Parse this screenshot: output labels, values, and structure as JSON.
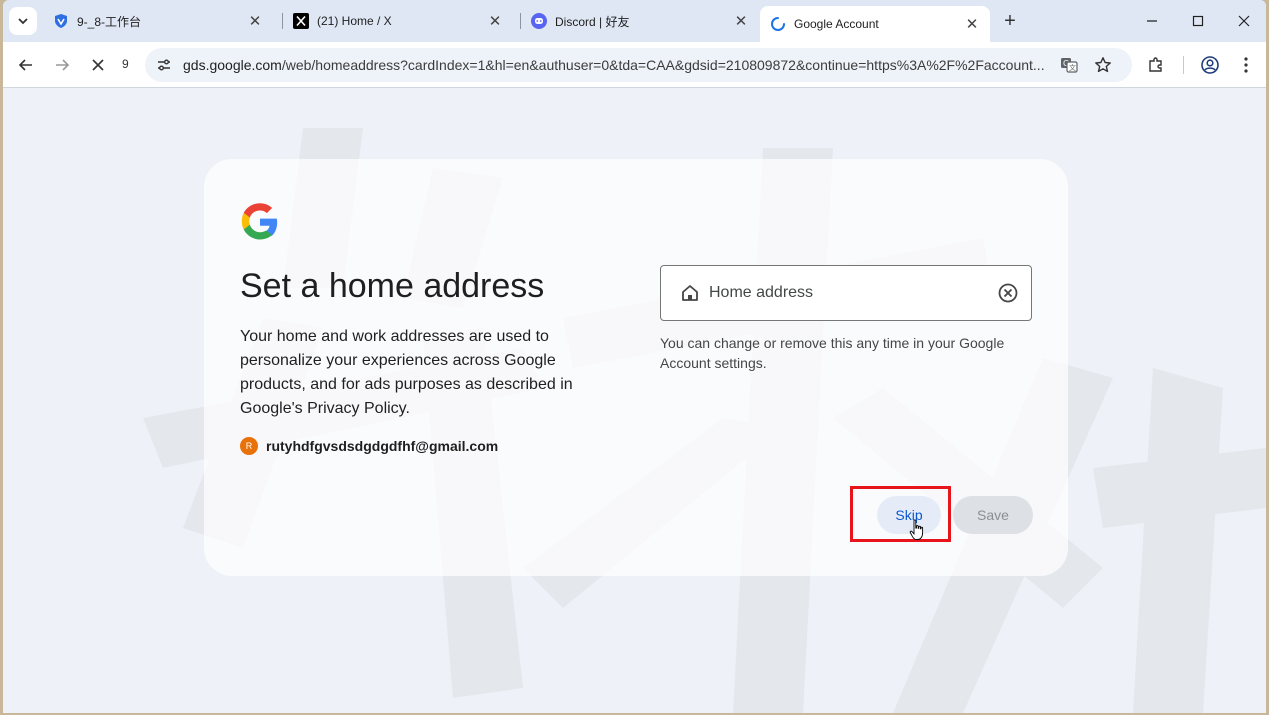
{
  "tabs": [
    {
      "title": "9-_8-工作台",
      "icon": "shield-v-icon"
    },
    {
      "title": "(21) Home / X",
      "icon": "x-logo-icon"
    },
    {
      "title": "Discord | 好友",
      "icon": "discord-icon"
    },
    {
      "title": "Google Account",
      "icon": "loading-spinner-icon",
      "active": true
    }
  ],
  "toolbar": {
    "reload_count": "9",
    "url_host": "gds.google.com",
    "url_path": "/web/homeaddress?cardIndex=1&hl=en&authuser=0&tda=CAA&gdsid=210809872&continue=https%3A%2F%2Faccount..."
  },
  "page": {
    "heading": "Set a home address",
    "description": "Your home and work addresses are used to personalize your experiences across Google products, and for ads purposes as described in Google's Privacy Policy.",
    "account_initial": "R",
    "account_email": "rutyhdfgvsdsdgdgdfhf@gmail.com",
    "address_placeholder": "Home address",
    "helper_text": "You can change or remove this any time in your Google Account settings.",
    "skip_label": "Skip",
    "save_label": "Save"
  },
  "colors": {
    "accent": "#0b57d0",
    "highlight": "#e8141b",
    "avatar": "#e8710a"
  }
}
